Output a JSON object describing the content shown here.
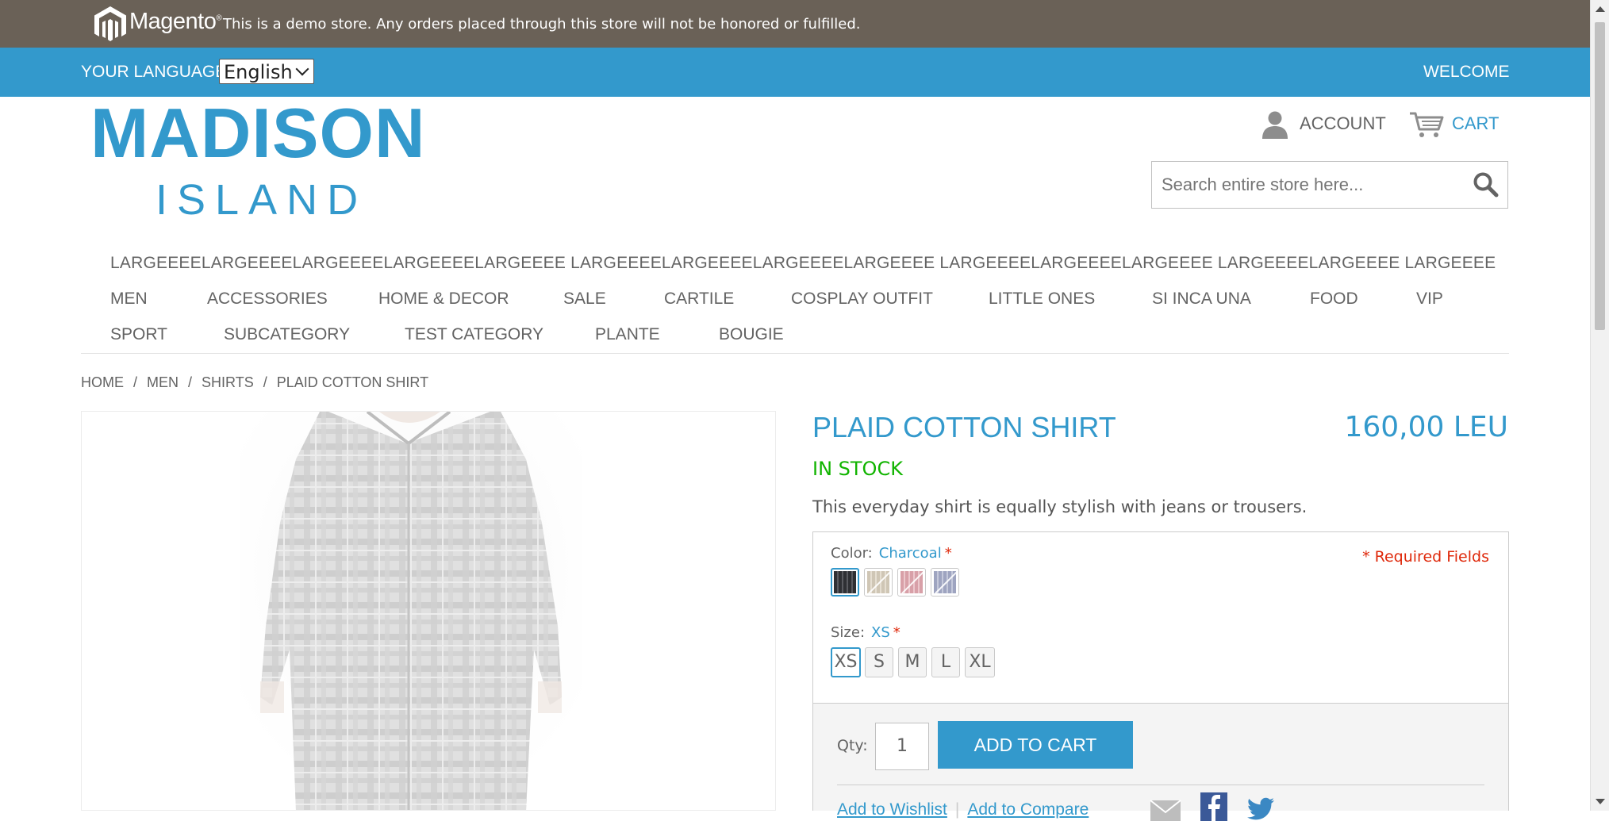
{
  "demo_notice": {
    "brand": "Magento",
    "text": "This is a demo store. Any orders placed through this store will not be honored or fulfilled."
  },
  "language_bar": {
    "label": "YOUR LANGUAGE:",
    "selected_language": "English",
    "welcome": "WELCOME"
  },
  "logo": {
    "line1": "MADISON",
    "line2": "ISLAND"
  },
  "header_links": {
    "account": "ACCOUNT",
    "cart": "CART"
  },
  "search": {
    "placeholder": "Search entire store here..."
  },
  "nav": {
    "long_item": "LARGEEEELARGEEEELARGEEEELARGEEEELARGEEEE LARGEEEELARGEEEELARGEEEELARGEEEE LARGEEEELARGEEEELARGEEEE LARGEEEELARGEEEE LARGEEEE",
    "row1": [
      "MEN",
      "ACCESSORIES",
      "HOME & DECOR",
      "SALE",
      "CARTILE",
      "COSPLAY OUTFIT",
      "LITTLE ONES",
      "SI INCA UNA",
      "FOOD",
      "VIP"
    ],
    "row2": [
      "SPORT",
      "SUBCATEGORY",
      "TEST CATEGORY",
      "PLANTE",
      "BOUGIE"
    ]
  },
  "breadcrumb": {
    "items": [
      "HOME",
      "MEN",
      "SHIRTS",
      "PLAID COTTON SHIRT"
    ],
    "separator": "/"
  },
  "product": {
    "name": "PLAID COTTON SHIRT",
    "price": "160,00 LEU",
    "stock": "IN STOCK",
    "short_description": "This everyday shirt is equally stylish with jeans or trousers."
  },
  "options": {
    "required_fields": "* Required Fields",
    "color_label": "Color:",
    "color_value": "Charcoal",
    "required_star": "*",
    "colors": [
      {
        "name": "Charcoal",
        "hex": "#2f3034",
        "selected": true,
        "available": true
      },
      {
        "name": "Khaki",
        "hex": "#cfc6b5",
        "selected": false,
        "available": false
      },
      {
        "name": "Red",
        "hex": "#d8a0a8",
        "selected": false,
        "available": false
      },
      {
        "name": "Blue",
        "hex": "#9ea4c0",
        "selected": false,
        "available": false
      }
    ],
    "size_label": "Size:",
    "size_value": "XS",
    "sizes": [
      "XS",
      "S",
      "M",
      "L",
      "XL"
    ]
  },
  "add_to_cart": {
    "qty_label": "Qty:",
    "qty_value": "1",
    "button_label": "ADD TO CART",
    "wishlist": "Add to Wishlist",
    "compare": "Add to Compare"
  },
  "colors": {
    "accent": "#3399cc",
    "demo_bar": "#6a6157",
    "in_stock": "#11b400",
    "required": "#df280a"
  }
}
